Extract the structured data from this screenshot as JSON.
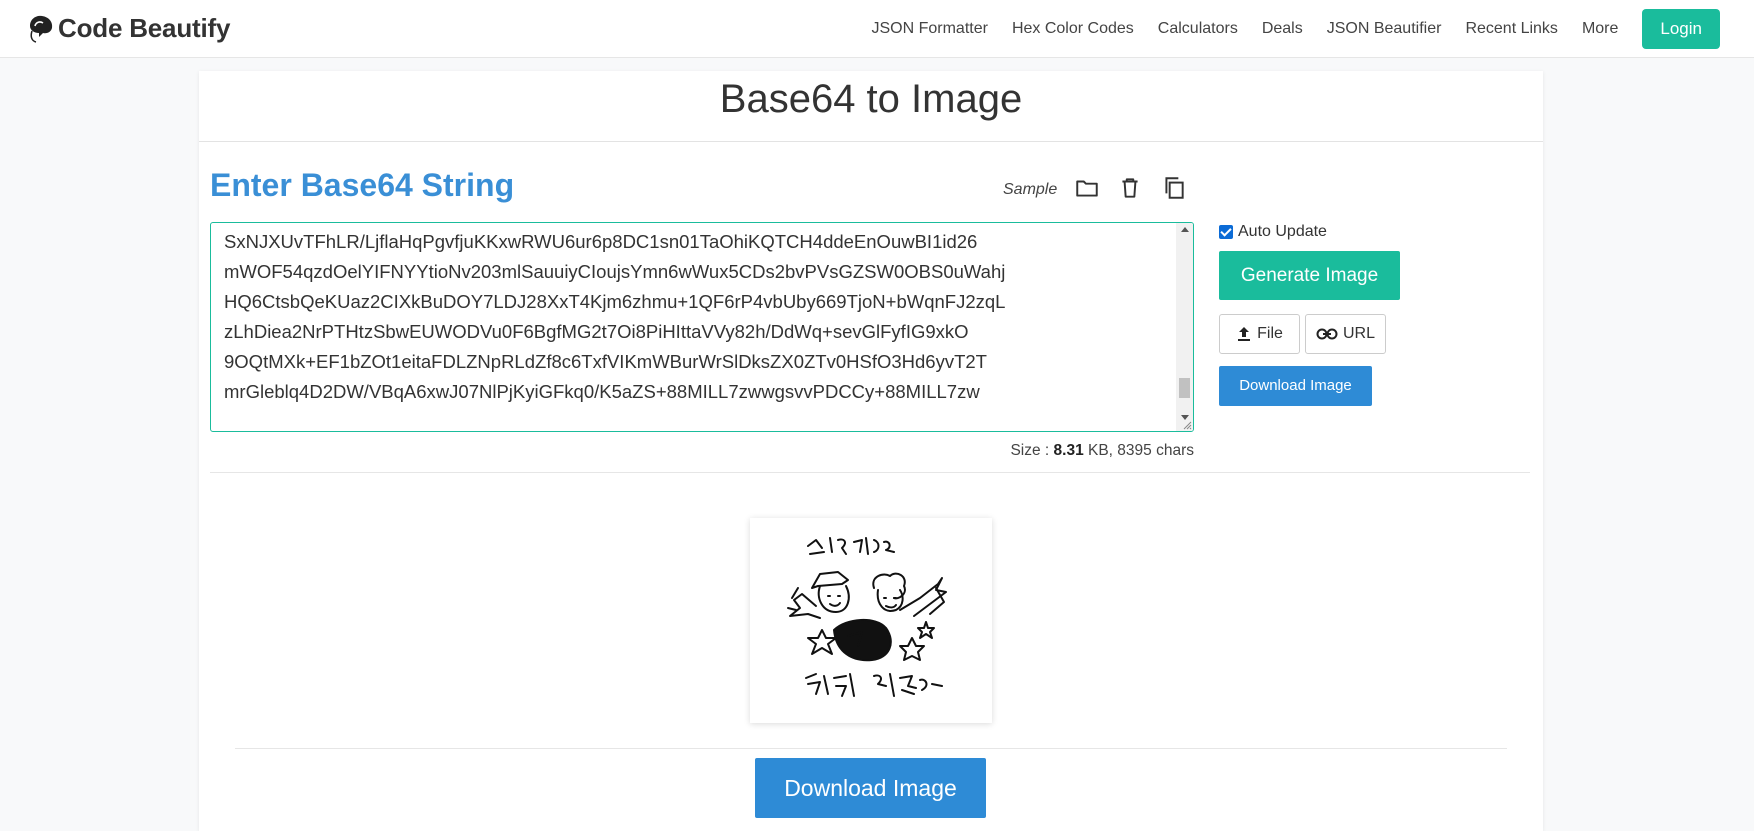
{
  "brand": {
    "name": "Code Beautify"
  },
  "nav": {
    "links": [
      "JSON Formatter",
      "Hex Color Codes",
      "Calculators",
      "Deals",
      "JSON Beautifier",
      "Recent Links",
      "More"
    ],
    "login": "Login"
  },
  "page": {
    "title": "Base64 to Image"
  },
  "input": {
    "heading": "Enter Base64 String",
    "sample": "Sample",
    "value": "SxNJXUvTFhLR/LjflaHqPgvfjuKKxwRWU6ur6p8DC1sn01TaOhiKQTCH4ddeEnOuwBI1id26\nmWOF54qzdOelYIFNYYtioNv203mlSauuiyCIoujsYmn6wWux5CDs2bvPVsGZSW0OBS0uWahj\nHQ6CtsbQeKUaz2CIXkBuDOY7LDJ28XxT4Kjm6zhmu+1QF6rP4vbUby669TjoN+bWqnFJ2zqL\nzLhDiea2NrPTHtzSbwEUWODVu0F6BgfMG2t7Oi8PiHIttaVVy82h/DdWq+sevGlFyfIG9xkO\n9OQtMXk+EF1bZOt1eitaFDLZNpRLdZf8c6TxfVIKmWBurWrSlDksZX0ZTv0HSfO3Hd6yvT2T\nmrGleblq4D2DW/VBqA6xwJ07NlPjKyiGFkq0/K5aZS+88MILL7zwwgsvvPDCCy+88MILL7zw"
  },
  "size": {
    "label": "Size :",
    "kb": "8.31",
    "unit": "KB,",
    "chars": "8395 chars"
  },
  "controls": {
    "auto_update": {
      "label": "Auto Update",
      "checked": true
    },
    "generate": "Generate Image",
    "file": "File",
    "url": "URL",
    "download_side": "Download Image"
  },
  "preview": {
    "download": "Download Image"
  },
  "icons": {
    "open": "folder-icon",
    "clear": "trash-icon",
    "copy": "copy-icon",
    "upload": "upload-icon",
    "link": "link-icon"
  },
  "colors": {
    "accent": "#1abc9c",
    "heading": "#3a8fd6",
    "download": "#2e8bd6"
  }
}
